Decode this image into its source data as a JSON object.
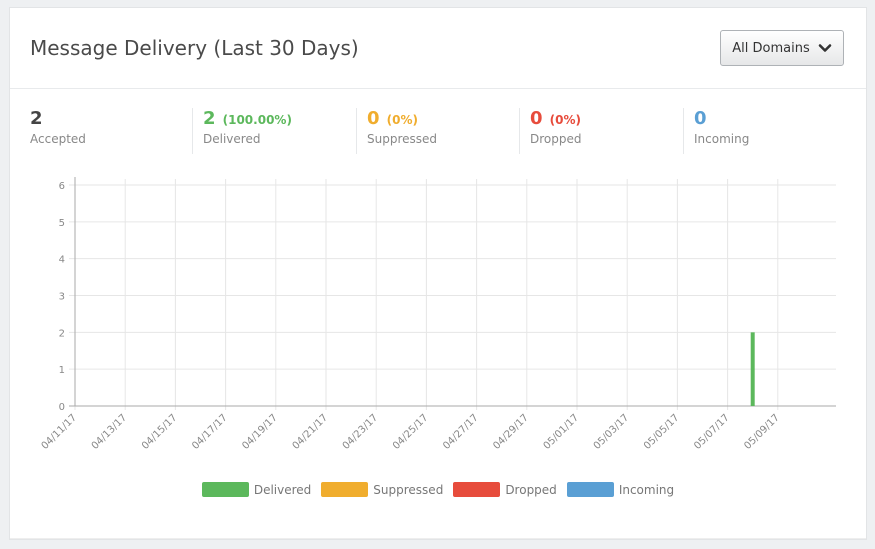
{
  "card": {
    "title": "Message Delivery (Last 30 Days)",
    "dropdown_label": "All Domains"
  },
  "stats": [
    {
      "id": "accepted",
      "value": "2",
      "pct": "",
      "label": "Accepted",
      "color": "#444444"
    },
    {
      "id": "delivered",
      "value": "2",
      "pct": "(100.00%)",
      "label": "Delivered",
      "color": "#5cb85c"
    },
    {
      "id": "suppressed",
      "value": "0",
      "pct": "(0%)",
      "label": "Suppressed",
      "color": "#f0ad2e"
    },
    {
      "id": "dropped",
      "value": "0",
      "pct": "(0%)",
      "label": "Dropped",
      "color": "#e74c3c"
    },
    {
      "id": "incoming",
      "value": "0",
      "pct": "",
      "label": "Incoming",
      "color": "#5a9fd4"
    }
  ],
  "icons": {
    "dropdown": "chevron-down-icon"
  },
  "chart_data": {
    "type": "bar",
    "x_tick_labels": [
      "04/11/17",
      "04/13/17",
      "04/15/17",
      "04/17/17",
      "04/19/17",
      "04/21/17",
      "04/23/17",
      "04/25/17",
      "04/27/17",
      "04/29/17",
      "05/01/17",
      "05/03/17",
      "05/05/17",
      "05/07/17",
      "05/09/17"
    ],
    "ylim": [
      0,
      6
    ],
    "yticks": [
      0,
      1,
      2,
      3,
      4,
      5,
      6
    ],
    "grid": true,
    "legend_position": "bottom-center",
    "series": [
      {
        "name": "Delivered",
        "color": "#5cb85c",
        "points": [
          {
            "x": "05/08/17",
            "y": 2
          }
        ]
      },
      {
        "name": "Suppressed",
        "color": "#f0ad2e",
        "points": []
      },
      {
        "name": "Dropped",
        "color": "#e74c3c",
        "points": []
      },
      {
        "name": "Incoming",
        "color": "#5a9fd4",
        "points": []
      }
    ]
  }
}
